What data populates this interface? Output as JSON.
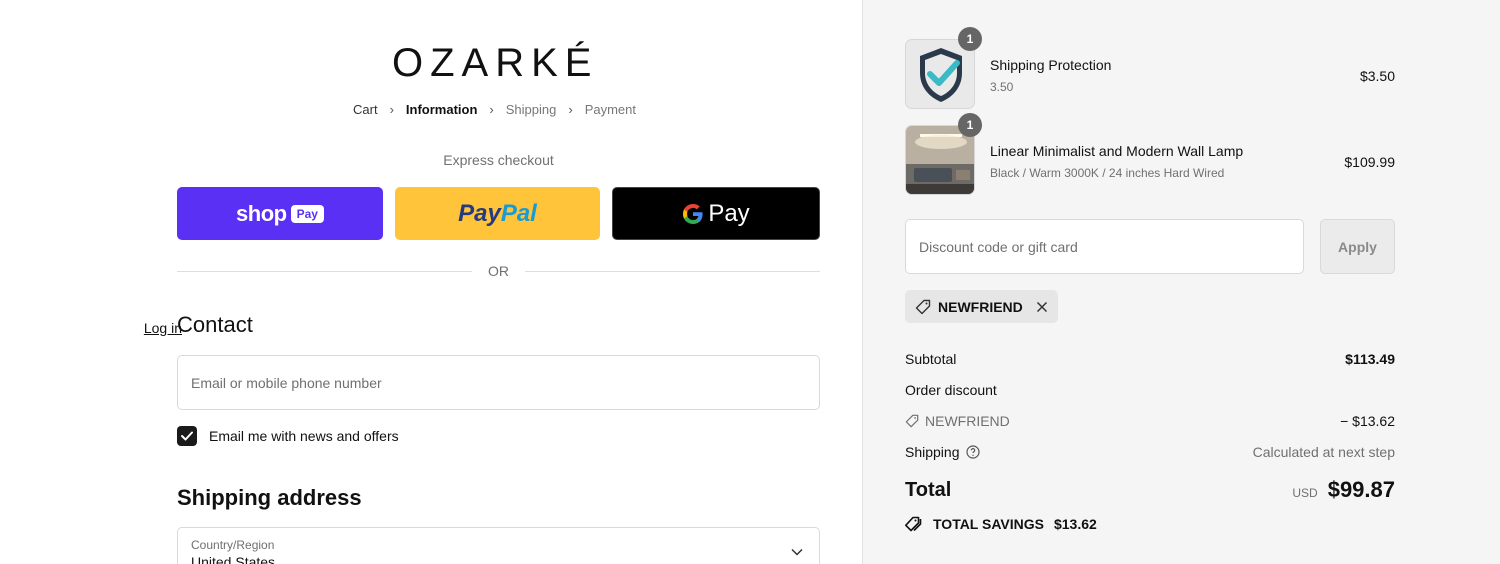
{
  "brand": {
    "logo_text": "OZARKÉ"
  },
  "breadcrumb": {
    "items": [
      "Cart",
      "Information",
      "Shipping",
      "Payment"
    ],
    "separator": "›"
  },
  "express": {
    "label": "Express checkout",
    "shop_pay": {
      "main": "shop",
      "badge": "Pay"
    },
    "paypal": {
      "part1": "Pay",
      "part2": "Pal"
    },
    "gpay": {
      "g": "G",
      "text": "Pay"
    },
    "or_label": "OR"
  },
  "contact": {
    "title": "Contact",
    "login_label": "Log in",
    "email_placeholder": "Email or mobile phone number",
    "newsletter_label": "Email me with news and offers",
    "newsletter_checked": true
  },
  "shipping_address": {
    "title": "Shipping address",
    "country_label": "Country/Region",
    "country_value": "United States"
  },
  "cart": {
    "items": [
      {
        "quantity": "1",
        "name": "Shipping Protection",
        "variant": "3.50",
        "price": "$3.50",
        "icon": "shield-check-icon"
      },
      {
        "quantity": "1",
        "name": "Linear Minimalist and Modern Wall Lamp",
        "variant": "Black / Warm 3000K / 24 inches Hard Wired",
        "price": "$109.99",
        "icon": "wall-lamp-photo"
      }
    ]
  },
  "discount": {
    "placeholder": "Discount code or gift card",
    "apply_label": "Apply",
    "applied_code": "NEWFRIEND"
  },
  "summary": {
    "subtotal_label": "Subtotal",
    "subtotal_value": "$113.49",
    "order_discount_label": "Order discount",
    "discount_code": "NEWFRIEND",
    "discount_value": "− $13.62",
    "shipping_label": "Shipping",
    "shipping_value": "Calculated at next step",
    "total_label": "Total",
    "currency": "USD",
    "total_value": "$99.87",
    "savings_label": "TOTAL SAVINGS",
    "savings_value": "$13.62"
  },
  "colors": {
    "shop_pay": "#5a31f4",
    "paypal": "#ffc439",
    "gpay": "#000000",
    "sidebar_bg": "#f5f5f5"
  }
}
